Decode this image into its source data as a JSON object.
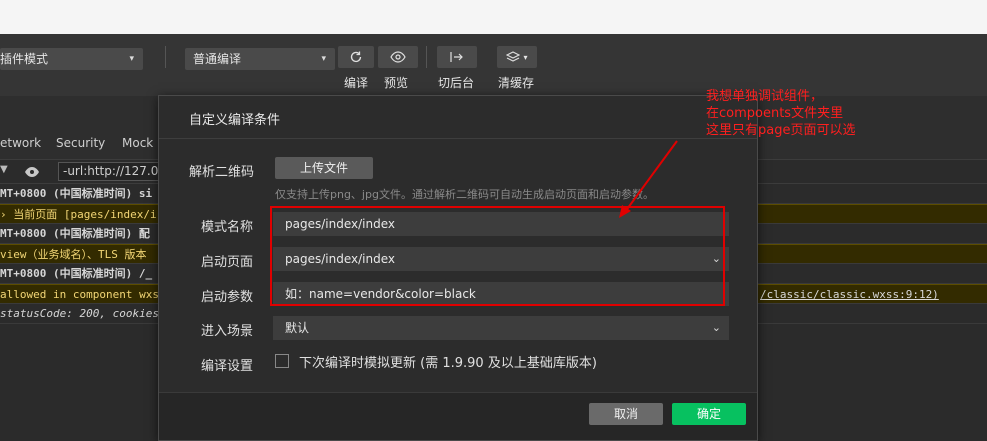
{
  "toolbar": {
    "mode_select": "插件模式",
    "compile_select": "普通编译",
    "buttons": {
      "compile": "编译",
      "preview": "预览",
      "background": "切后台",
      "clear_cache": "清缓存"
    }
  },
  "devtools": {
    "tabs": [
      "etwork",
      "Security",
      "Mock"
    ],
    "filter_value": "-url:http://127.0.0.",
    "logs": [
      {
        "text": "MT+0800 (中国标准时间) si",
        "style": "plain"
      },
      {
        "text": "› 当前页面 [pages/index/i",
        "style": "yellow"
      },
      {
        "text": "MT+0800 (中国标准时间) 配",
        "style": "plain"
      },
      {
        "text": "view（业务域名）、TLS 版本",
        "style": "yellow"
      },
      {
        "text": "MT+0800 (中国标准时间) /_",
        "style": "plain"
      },
      {
        "text": " allowed in component wxs",
        "style": "yellow",
        "right": "/classic/classic.wxss:9:12)"
      },
      {
        "text": " statusCode: 200, cookies",
        "style": "plain"
      }
    ]
  },
  "dialog": {
    "title": "自定义编译条件",
    "qr_label": "解析二维码",
    "upload_label": "上传文件",
    "upload_hint": "仅支持上传png、jpg文件。通过解析二维码可自动生成启动页面和启动参数。",
    "mode_name_label": "模式名称",
    "mode_name_value": "pages/index/index",
    "start_page_label": "启动页面",
    "start_page_value": "pages/index/index",
    "start_params_label": "启动参数",
    "start_params_placeholder": "如：name=vendor&color=black",
    "scene_label": "进入场景",
    "scene_value": "默认",
    "compile_settings_label": "编译设置",
    "compile_checkbox_text": "下次编译时模拟更新 (需 1.9.90 及以上基础库版本)",
    "cancel_label": "取消",
    "ok_label": "确定"
  },
  "annotation": {
    "lines": [
      "我想单独调试组件，",
      "在compoents文件夹里",
      "这里只有page页面可以选"
    ],
    "color": "#ff1f1f"
  }
}
